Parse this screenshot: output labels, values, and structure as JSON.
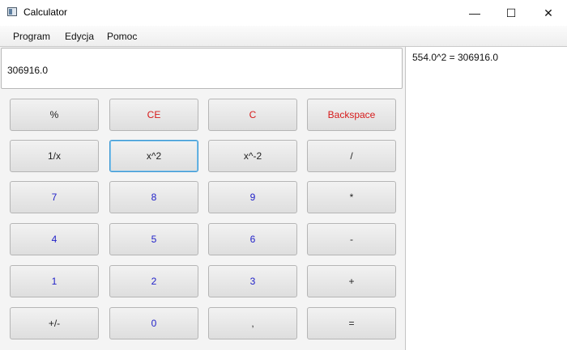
{
  "window": {
    "title": "Calculator",
    "minimize_glyph": "—",
    "maximize_glyph": "☐",
    "close_glyph": "✕"
  },
  "menu": [
    "Program",
    "Edycja",
    "Pomoc"
  ],
  "display": {
    "value": "306916.0"
  },
  "history": [
    "554.0^2 = 306916.0"
  ],
  "keys": [
    [
      "%",
      "CE",
      "C",
      "Backspace"
    ],
    [
      "1/x",
      "x^2",
      "x^-2",
      "/"
    ],
    [
      "7",
      "8",
      "9",
      "*"
    ],
    [
      "4",
      "5",
      "6",
      "-"
    ],
    [
      "1",
      "2",
      "3",
      "+"
    ],
    [
      "+/-",
      "0",
      ",",
      "="
    ]
  ],
  "colors": {
    "accent_red": "#d61a1a",
    "digit_blue": "#2020c8",
    "focus_blue": "#3d98d3"
  }
}
